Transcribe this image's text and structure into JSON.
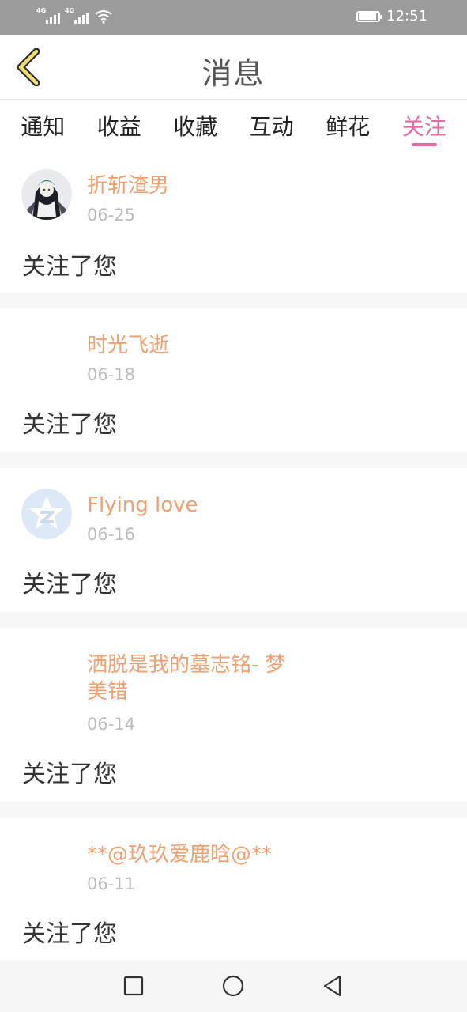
{
  "status_bar": {
    "signal1_label": "4G",
    "signal2_label": "4G",
    "time": "12:51"
  },
  "header": {
    "title": "消息",
    "back_icon": "chevron-left-icon"
  },
  "tabs": [
    {
      "label": "通知",
      "active": false
    },
    {
      "label": "收益",
      "active": false
    },
    {
      "label": "收藏",
      "active": false
    },
    {
      "label": "互动",
      "active": false
    },
    {
      "label": "鲜花",
      "active": false
    },
    {
      "label": "关注",
      "active": true
    }
  ],
  "messages": [
    {
      "name": "折斩渣男",
      "date": "06-25",
      "text": "关注了您",
      "avatar": "anime-avatar"
    },
    {
      "name": "时光飞逝",
      "date": "06-18",
      "text": "关注了您",
      "avatar": "none"
    },
    {
      "name": "Flying love",
      "date": "06-16",
      "text": "关注了您",
      "avatar": "qzone-star-avatar"
    },
    {
      "name_line1": "洒脱是我的墓志铭- 梦",
      "name_line2": "美错",
      "date": "06-14",
      "text": "关注了您",
      "avatar": "none"
    },
    {
      "name": "**@玖玖爱鹿晗@**",
      "date": "06-11",
      "text": "关注了您",
      "avatar": "none"
    }
  ],
  "colors": {
    "accent": "#e96aa2",
    "username": "#f0a070",
    "date": "#bbbbbb",
    "back_icon_fill": "#f1e070"
  },
  "navbar": {
    "icons": [
      "recent-apps-icon",
      "home-icon",
      "back-icon"
    ]
  }
}
